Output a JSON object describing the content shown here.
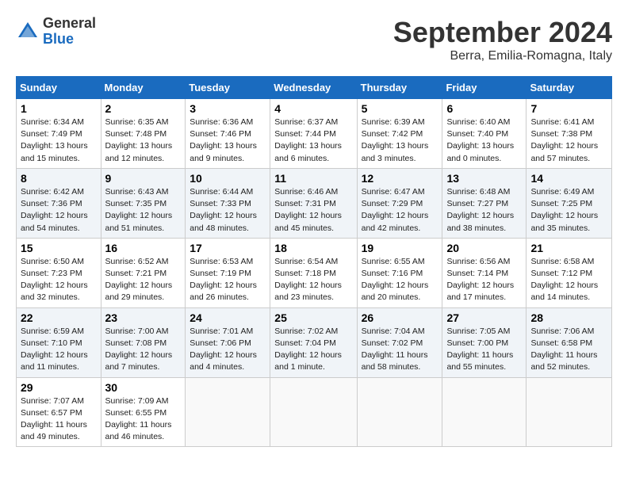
{
  "header": {
    "logo_general": "General",
    "logo_blue": "Blue",
    "month_title": "September 2024",
    "subtitle": "Berra, Emilia-Romagna, Italy"
  },
  "weekdays": [
    "Sunday",
    "Monday",
    "Tuesday",
    "Wednesday",
    "Thursday",
    "Friday",
    "Saturday"
  ],
  "weeks": [
    [
      {
        "day": "1",
        "info": "Sunrise: 6:34 AM\nSunset: 7:49 PM\nDaylight: 13 hours\nand 15 minutes."
      },
      {
        "day": "2",
        "info": "Sunrise: 6:35 AM\nSunset: 7:48 PM\nDaylight: 13 hours\nand 12 minutes."
      },
      {
        "day": "3",
        "info": "Sunrise: 6:36 AM\nSunset: 7:46 PM\nDaylight: 13 hours\nand 9 minutes."
      },
      {
        "day": "4",
        "info": "Sunrise: 6:37 AM\nSunset: 7:44 PM\nDaylight: 13 hours\nand 6 minutes."
      },
      {
        "day": "5",
        "info": "Sunrise: 6:39 AM\nSunset: 7:42 PM\nDaylight: 13 hours\nand 3 minutes."
      },
      {
        "day": "6",
        "info": "Sunrise: 6:40 AM\nSunset: 7:40 PM\nDaylight: 13 hours\nand 0 minutes."
      },
      {
        "day": "7",
        "info": "Sunrise: 6:41 AM\nSunset: 7:38 PM\nDaylight: 12 hours\nand 57 minutes."
      }
    ],
    [
      {
        "day": "8",
        "info": "Sunrise: 6:42 AM\nSunset: 7:36 PM\nDaylight: 12 hours\nand 54 minutes."
      },
      {
        "day": "9",
        "info": "Sunrise: 6:43 AM\nSunset: 7:35 PM\nDaylight: 12 hours\nand 51 minutes."
      },
      {
        "day": "10",
        "info": "Sunrise: 6:44 AM\nSunset: 7:33 PM\nDaylight: 12 hours\nand 48 minutes."
      },
      {
        "day": "11",
        "info": "Sunrise: 6:46 AM\nSunset: 7:31 PM\nDaylight: 12 hours\nand 45 minutes."
      },
      {
        "day": "12",
        "info": "Sunrise: 6:47 AM\nSunset: 7:29 PM\nDaylight: 12 hours\nand 42 minutes."
      },
      {
        "day": "13",
        "info": "Sunrise: 6:48 AM\nSunset: 7:27 PM\nDaylight: 12 hours\nand 38 minutes."
      },
      {
        "day": "14",
        "info": "Sunrise: 6:49 AM\nSunset: 7:25 PM\nDaylight: 12 hours\nand 35 minutes."
      }
    ],
    [
      {
        "day": "15",
        "info": "Sunrise: 6:50 AM\nSunset: 7:23 PM\nDaylight: 12 hours\nand 32 minutes."
      },
      {
        "day": "16",
        "info": "Sunrise: 6:52 AM\nSunset: 7:21 PM\nDaylight: 12 hours\nand 29 minutes."
      },
      {
        "day": "17",
        "info": "Sunrise: 6:53 AM\nSunset: 7:19 PM\nDaylight: 12 hours\nand 26 minutes."
      },
      {
        "day": "18",
        "info": "Sunrise: 6:54 AM\nSunset: 7:18 PM\nDaylight: 12 hours\nand 23 minutes."
      },
      {
        "day": "19",
        "info": "Sunrise: 6:55 AM\nSunset: 7:16 PM\nDaylight: 12 hours\nand 20 minutes."
      },
      {
        "day": "20",
        "info": "Sunrise: 6:56 AM\nSunset: 7:14 PM\nDaylight: 12 hours\nand 17 minutes."
      },
      {
        "day": "21",
        "info": "Sunrise: 6:58 AM\nSunset: 7:12 PM\nDaylight: 12 hours\nand 14 minutes."
      }
    ],
    [
      {
        "day": "22",
        "info": "Sunrise: 6:59 AM\nSunset: 7:10 PM\nDaylight: 12 hours\nand 11 minutes."
      },
      {
        "day": "23",
        "info": "Sunrise: 7:00 AM\nSunset: 7:08 PM\nDaylight: 12 hours\nand 7 minutes."
      },
      {
        "day": "24",
        "info": "Sunrise: 7:01 AM\nSunset: 7:06 PM\nDaylight: 12 hours\nand 4 minutes."
      },
      {
        "day": "25",
        "info": "Sunrise: 7:02 AM\nSunset: 7:04 PM\nDaylight: 12 hours\nand 1 minute."
      },
      {
        "day": "26",
        "info": "Sunrise: 7:04 AM\nSunset: 7:02 PM\nDaylight: 11 hours\nand 58 minutes."
      },
      {
        "day": "27",
        "info": "Sunrise: 7:05 AM\nSunset: 7:00 PM\nDaylight: 11 hours\nand 55 minutes."
      },
      {
        "day": "28",
        "info": "Sunrise: 7:06 AM\nSunset: 6:58 PM\nDaylight: 11 hours\nand 52 minutes."
      }
    ],
    [
      {
        "day": "29",
        "info": "Sunrise: 7:07 AM\nSunset: 6:57 PM\nDaylight: 11 hours\nand 49 minutes."
      },
      {
        "day": "30",
        "info": "Sunrise: 7:09 AM\nSunset: 6:55 PM\nDaylight: 11 hours\nand 46 minutes."
      },
      {
        "day": "",
        "info": ""
      },
      {
        "day": "",
        "info": ""
      },
      {
        "day": "",
        "info": ""
      },
      {
        "day": "",
        "info": ""
      },
      {
        "day": "",
        "info": ""
      }
    ]
  ]
}
